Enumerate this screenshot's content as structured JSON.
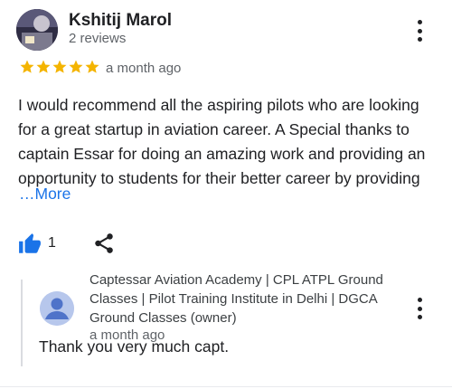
{
  "review": {
    "reviewer_name": "Kshitij Marol",
    "reviewer_reviews": "2 reviews",
    "rating": 5,
    "rating_max": 5,
    "time": "a month ago",
    "text": "I would recommend all the aspiring pilots who are looking for a great startup in aviation career. A Special thanks to captain Essar for doing an amazing work and providing an opportunity to students for their better career by providing",
    "more_label": "…More",
    "like_count": "1"
  },
  "owner_response": {
    "name": "Captessar Aviation Academy | CPL ATPL Ground Classes | Pilot Training Institute in Delhi | DGCA Ground Classes (owner)",
    "time": "a month ago",
    "text": "Thank you very much capt."
  },
  "icons": {
    "star": "star-icon",
    "like": "thumbs-up-icon",
    "share": "share-icon",
    "menu": "more-vert-icon"
  },
  "colors": {
    "star": "#f4b400",
    "link": "#1a73e8",
    "like": "#1a73e8",
    "owner_avatar": "#4f73c9"
  }
}
